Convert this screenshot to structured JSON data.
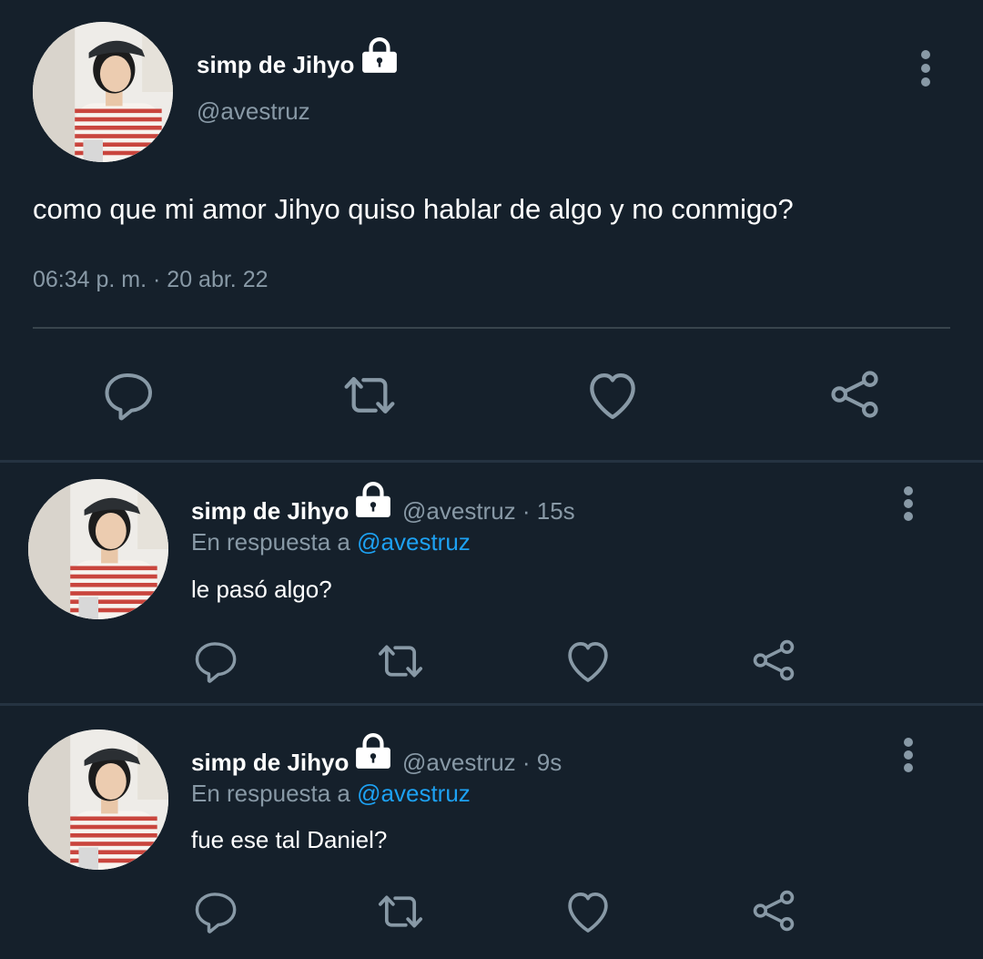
{
  "main_tweet": {
    "display_name": "simp de Jihyo",
    "handle": "@avestruz",
    "text": "como que mi amor Jihyo quiso hablar de algo y no conmigo?",
    "timestamp": "06:34 p. m. · 20 abr. 22"
  },
  "replies": [
    {
      "display_name": "simp de Jihyo",
      "handle_time": "@avestruz · 15s",
      "reply_prefix": "En respuesta a",
      "reply_to": "@avestruz",
      "text": "le pasó algo?"
    },
    {
      "display_name": "simp de Jihyo",
      "handle_time": "@avestruz · 9s",
      "reply_prefix": "En respuesta a",
      "reply_to": "@avestruz",
      "text": "fue ese tal Daniel?"
    }
  ],
  "icons": {
    "protected": "lock-icon",
    "more": "more-vertical-icon",
    "actions": [
      "reply-icon",
      "retweet-icon",
      "like-icon",
      "share-icon"
    ]
  },
  "colors": {
    "background": "#15202b",
    "muted_text": "#8899a6",
    "link": "#1da1f2",
    "divider": "#38444d"
  }
}
